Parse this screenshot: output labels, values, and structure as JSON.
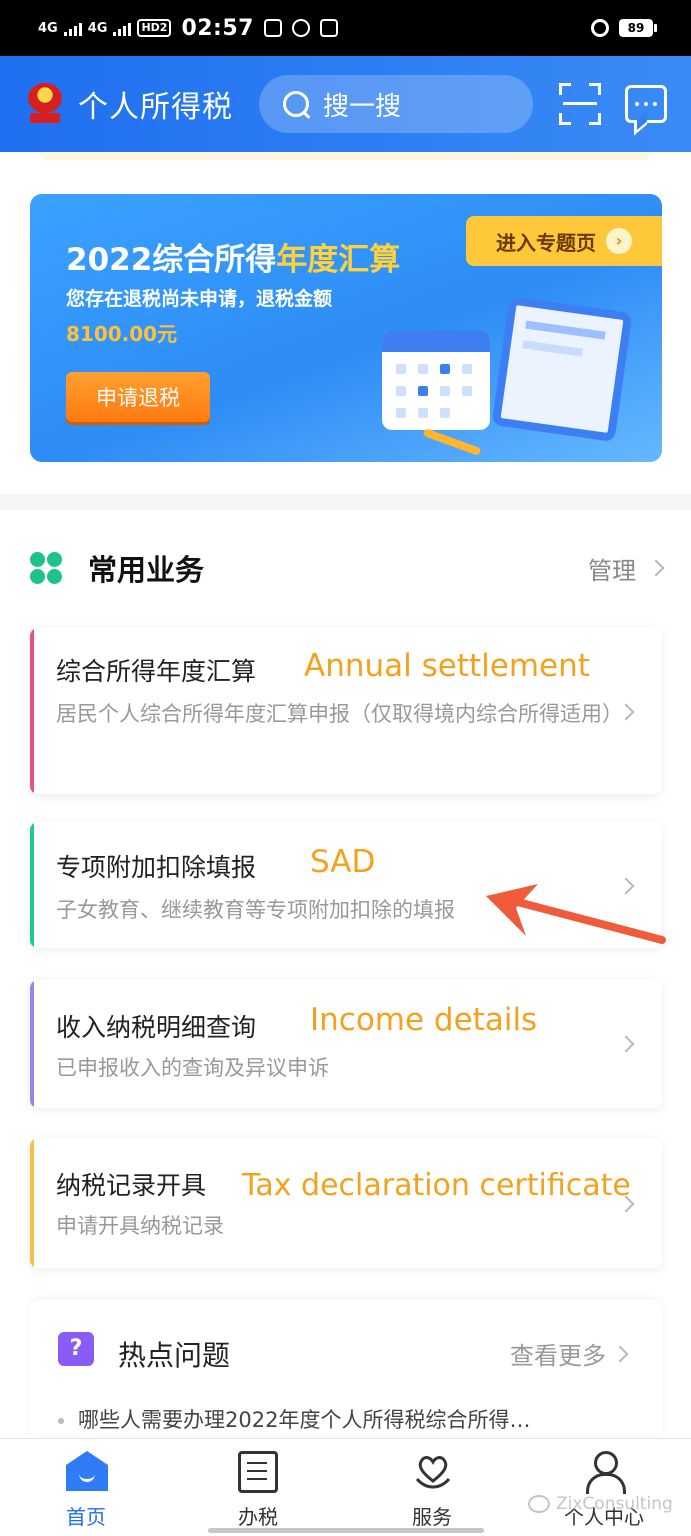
{
  "status_bar": {
    "network1": "4G",
    "network2": "4G",
    "hd": "HD2",
    "time": "02:57",
    "battery": "89"
  },
  "header": {
    "app_title": "个人所得税",
    "search_placeholder": "搜一搜",
    "icons": [
      "scan-icon",
      "message-icon"
    ]
  },
  "banner": {
    "title_prefix": "2022综合所得",
    "title_highlight": "年度汇算",
    "subtitle": "您存在退税尚未申请，退税金额",
    "amount": "8100.00元",
    "button_label": "申请退税",
    "topic_link": "进入专题页",
    "colors": {
      "highlight": "#ffd23c",
      "button": "#ff8a1e"
    }
  },
  "common_services": {
    "title": "常用业务",
    "manage_label": "管理",
    "items": [
      {
        "title": "综合所得年度汇算",
        "english": "Annual settlement",
        "desc": "居民个人综合所得年度汇算申报（仅取得境内综合所得适用）",
        "accent": "#e9557a"
      },
      {
        "title": "专项附加扣除填报",
        "english": "SAD",
        "desc": "子女教育、继续教育等专项附加扣除的填报",
        "accent": "#22c98c"
      },
      {
        "title": "收入纳税明细查询",
        "english": "Income details",
        "desc": "已申报收入的查询及异议申诉",
        "accent": "#9a82ef"
      },
      {
        "title": "纳税记录开具",
        "english": "Tax declaration certificate",
        "desc": "申请开具纳税记录",
        "accent": "#f3c04a"
      }
    ]
  },
  "hot_topics": {
    "title": "热点问题",
    "more_label": "查看更多",
    "first_item": "哪些人需要办理2022年度个人所得税综合所得…"
  },
  "tabbar": {
    "tabs": [
      {
        "label": "首页",
        "active": true
      },
      {
        "label": "办税",
        "active": false
      },
      {
        "label": "服务",
        "active": false
      },
      {
        "label": "个人中心",
        "active": false
      }
    ]
  },
  "watermark": "ZixConsulting"
}
